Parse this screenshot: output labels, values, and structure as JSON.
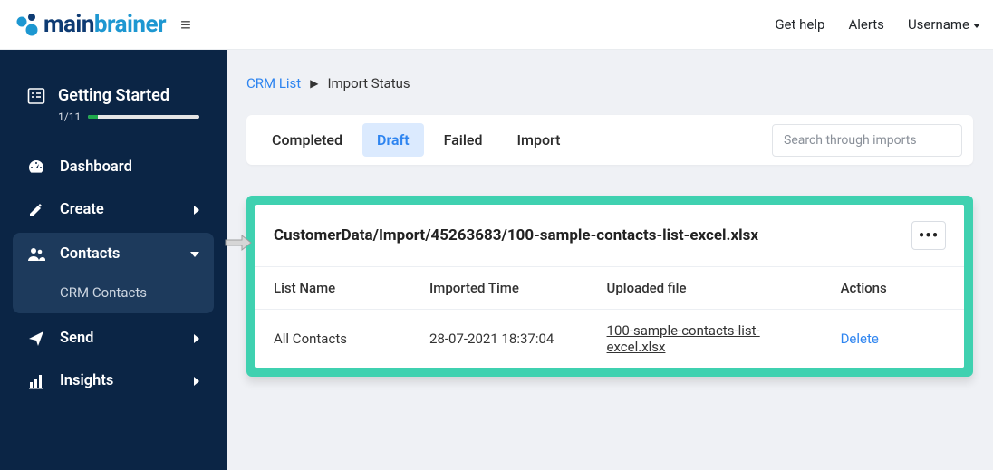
{
  "header": {
    "logo_main": "main",
    "logo_brainer": "brainer",
    "get_help": "Get help",
    "alerts": "Alerts",
    "username": "Username"
  },
  "sidebar": {
    "getting_started": {
      "label": "Getting Started",
      "progress_text": "1/11"
    },
    "dashboard": "Dashboard",
    "create": "Create",
    "contacts": "Contacts",
    "crm_contacts": "CRM Contacts",
    "send": "Send",
    "insights": "Insights"
  },
  "breadcrumb": {
    "link": "CRM List",
    "current": "Import Status"
  },
  "tabs": {
    "completed": "Completed",
    "draft": "Draft",
    "failed": "Failed",
    "import": "Import"
  },
  "search": {
    "placeholder": "Search through imports"
  },
  "panel": {
    "file_title": "CustomerData/Import/45263683/100-sample-contacts-list-excel.xlsx",
    "more": "•••",
    "columns": {
      "list_name": "List Name",
      "imported_time": "Imported Time",
      "uploaded_file": "Uploaded file",
      "actions": "Actions"
    },
    "row": {
      "list_name": "All Contacts",
      "imported_time": "28-07-2021 18:37:04",
      "uploaded_file": "100-sample-contacts-list-excel.xlsx",
      "action": "Delete"
    }
  }
}
